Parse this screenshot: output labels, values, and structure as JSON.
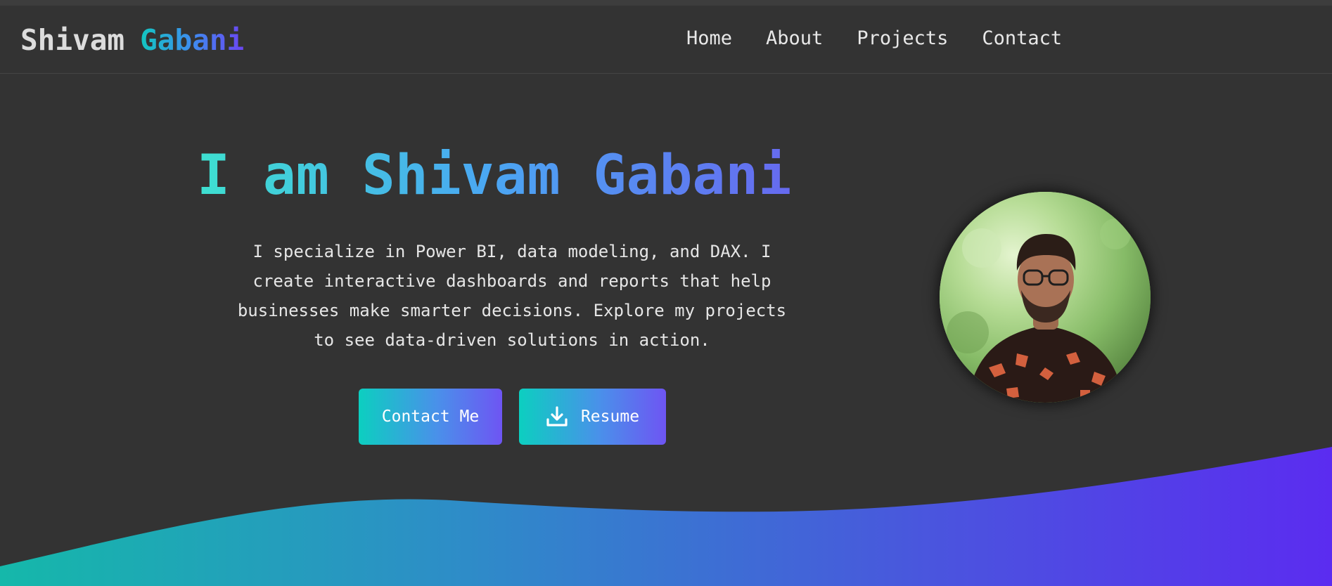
{
  "logo": {
    "first_name": "Shivam",
    "last_name": "Gabani"
  },
  "nav": {
    "items": [
      {
        "label": "Home"
      },
      {
        "label": "About"
      },
      {
        "label": "Projects"
      },
      {
        "label": "Contact"
      }
    ]
  },
  "hero": {
    "title": "I am Shivam Gabani",
    "description": "I specialize in Power BI, data modeling, and DAX. I create interactive dashboards and reports that help businesses make smarter decisions. Explore my projects to see data-driven solutions in action.",
    "contact_button": "Contact Me",
    "resume_button": "Resume",
    "resume_icon": "download-icon",
    "avatar_alt": "profile-photo"
  },
  "colors": {
    "background": "#333333",
    "accent_start": "#12c7c0",
    "accent_mid": "#3e8cf0",
    "accent_end": "#6b45f2"
  }
}
